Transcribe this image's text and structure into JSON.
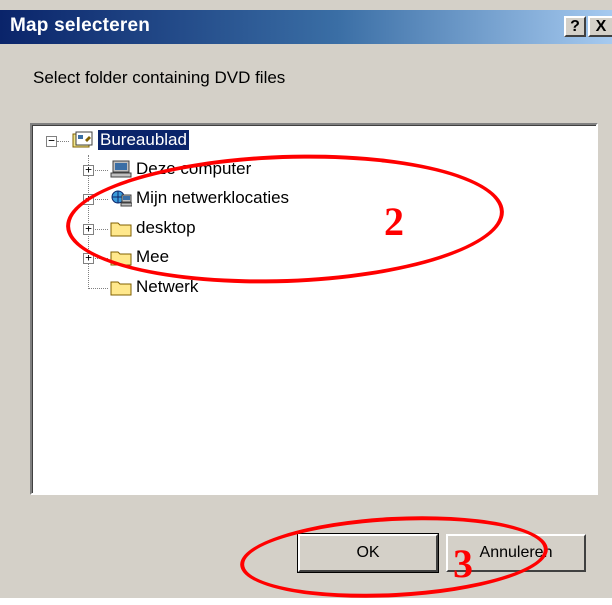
{
  "window": {
    "title": "Map selecteren",
    "help_glyph": "?",
    "close_glyph": "X"
  },
  "prompt": "Select folder containing DVD files",
  "tree": {
    "root": {
      "label": "Bureaublad",
      "icon": "desktop-icon",
      "expander": "−"
    },
    "children": [
      {
        "label": "Deze computer",
        "icon": "computer-icon",
        "expander": "+"
      },
      {
        "label": "Mijn netwerklocaties",
        "icon": "network-places-icon",
        "expander": "+"
      },
      {
        "label": "desktop",
        "icon": "folder-icon",
        "expander": "+"
      },
      {
        "label": "Mee",
        "icon": "folder-icon",
        "expander": "+"
      },
      {
        "label": "Netwerk",
        "icon": "folder-icon",
        "expander": ""
      }
    ]
  },
  "buttons": {
    "ok": "OK",
    "cancel": "Annuleren"
  },
  "annotations": {
    "tree_marker": "2",
    "ok_marker": "3",
    "color": "#ff0000"
  }
}
